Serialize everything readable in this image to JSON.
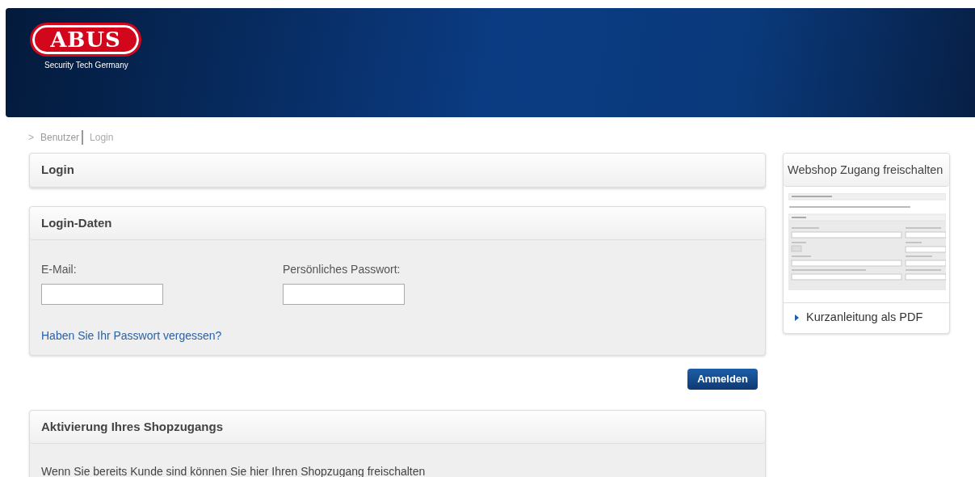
{
  "header": {
    "logo": "ABUS",
    "tagline": "Security Tech Germany"
  },
  "breadcrumb": {
    "separator": ">",
    "items": [
      {
        "label": "Benutzer",
        "current": false
      },
      {
        "label": "Login",
        "current": true
      }
    ]
  },
  "login_panel": {
    "title": "Login"
  },
  "login_data": {
    "title": "Login-Daten",
    "fields": [
      {
        "label": "E-Mail:"
      },
      {
        "label": "Persönliches Passwort:"
      }
    ],
    "forgot_link": "Haben Sie Ihr Passwort vergessen?"
  },
  "submit_button": "Anmelden",
  "activation_panel": {
    "title": "Aktivierung Ihres Shopzugangs",
    "text": "Wenn Sie bereits Kunde sind können Sie hier Ihren Shopzugang freischalten"
  },
  "sidebar": {
    "title": "Webshop Zugang freischalten",
    "link": "Kurzanleitung als PDF"
  }
}
